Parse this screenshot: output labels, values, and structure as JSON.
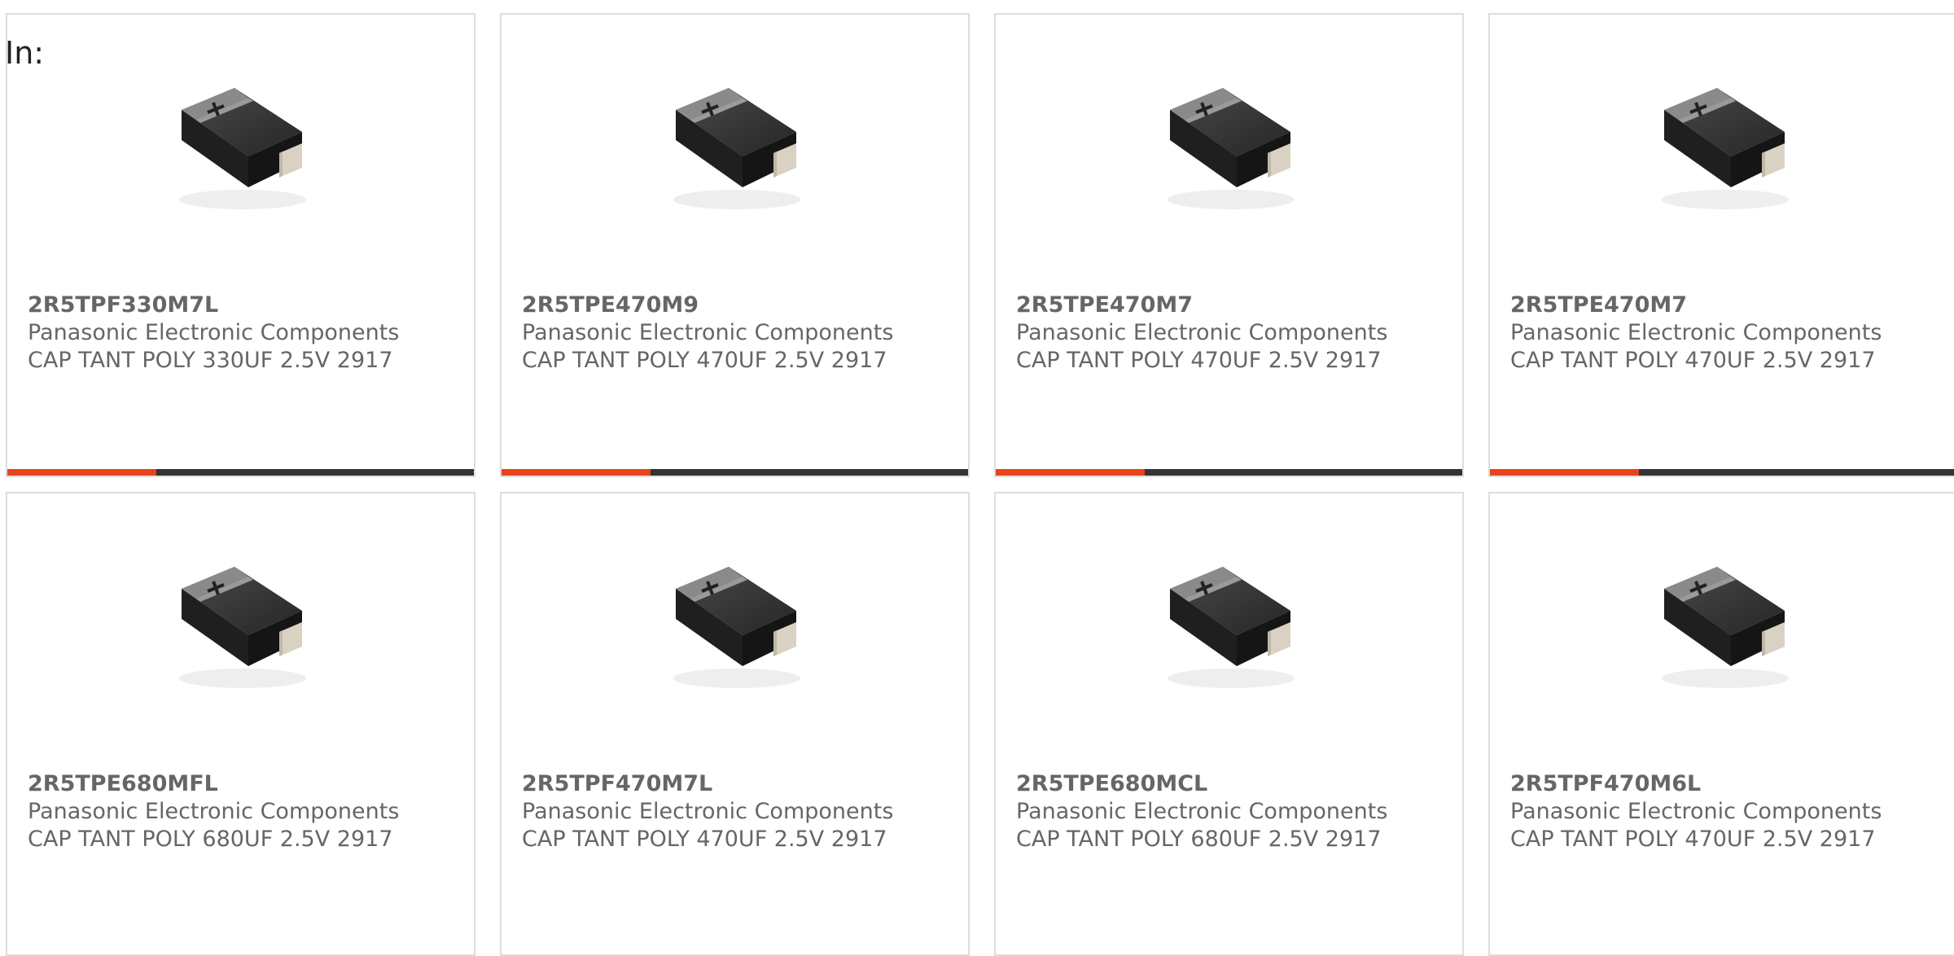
{
  "filter_prefix": "In:",
  "colors": {
    "accent": "#e8431d",
    "bar_track": "#333333",
    "text": "#666666",
    "card_border": "#dddddd"
  },
  "products": [
    {
      "part_number": "2R5TPF330M7L",
      "manufacturer": "Panasonic Electronic Components",
      "description": "CAP TANT POLY 330UF 2.5V 2917",
      "image_icon": "tantalum-capacitor-icon",
      "progress": 0.32
    },
    {
      "part_number": "2R5TPE470M9",
      "manufacturer": "Panasonic Electronic Components",
      "description": "CAP TANT POLY 470UF 2.5V 2917",
      "image_icon": "tantalum-capacitor-icon",
      "progress": 0.32
    },
    {
      "part_number": "2R5TPE470M7",
      "manufacturer": "Panasonic Electronic Components",
      "description": "CAP TANT POLY 470UF 2.5V 2917",
      "image_icon": "tantalum-capacitor-icon",
      "progress": 0.32
    },
    {
      "part_number": "2R5TPE470M7",
      "manufacturer": "Panasonic Electronic Components",
      "description": "CAP TANT POLY 470UF 2.5V 2917",
      "image_icon": "tantalum-capacitor-icon",
      "progress": 0.32
    },
    {
      "part_number": "2R5TPE680MFL",
      "manufacturer": "Panasonic Electronic Components",
      "description": "CAP TANT POLY 680UF 2.5V 2917",
      "image_icon": "tantalum-capacitor-icon"
    },
    {
      "part_number": "2R5TPF470M7L",
      "manufacturer": "Panasonic Electronic Components",
      "description": "CAP TANT POLY 470UF 2.5V 2917",
      "image_icon": "tantalum-capacitor-icon"
    },
    {
      "part_number": "2R5TPE680MCL",
      "manufacturer": "Panasonic Electronic Components",
      "description": "CAP TANT POLY 680UF 2.5V 2917",
      "image_icon": "tantalum-capacitor-icon"
    },
    {
      "part_number": "2R5TPF470M6L",
      "manufacturer": "Panasonic Electronic Components",
      "description": "CAP TANT POLY 470UF 2.5V 2917",
      "image_icon": "tantalum-capacitor-icon"
    }
  ]
}
